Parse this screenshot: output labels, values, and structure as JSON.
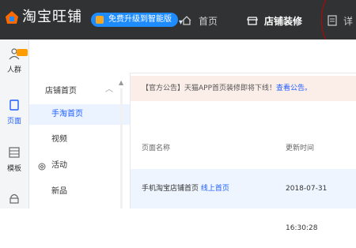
{
  "topbar": {
    "brand": "淘宝旺铺",
    "upgrade_pill": "免费升级到智能版",
    "nav_home": "首页",
    "nav_decor": "店铺装修",
    "nav_detail": "详"
  },
  "leftbar": {
    "people": "人群",
    "page": "页面",
    "module": "模板",
    "more": ""
  },
  "pagelist": {
    "title": "店铺首页",
    "items": [
      "手淘首页",
      "视频",
      "活动",
      "新品"
    ]
  },
  "notice": {
    "text": "【官方公告】天猫APP首页装修即将下线！",
    "link": "查看公告。"
  },
  "table": {
    "col_name": "页面名称",
    "col_time": "更新时间",
    "rows": [
      {
        "name": "手机淘宝店铺首页",
        "status": "线上首页",
        "time": "2018-07-31 16:30:28"
      }
    ]
  },
  "colors": {
    "topbar_bg": "#303233",
    "accent_blue": "#1e5cff",
    "notice_bg": "#fbeee8",
    "highlight_red": "#c40000"
  }
}
